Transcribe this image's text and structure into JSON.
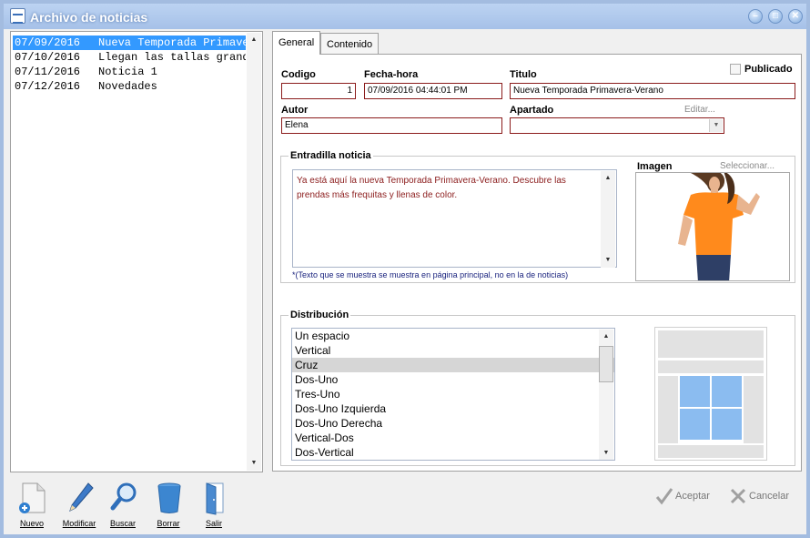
{
  "window": {
    "title": "Archivo de noticias"
  },
  "news_list": [
    {
      "date": "07/09/2016",
      "title": "Nueva Temporada Primavera-Verano",
      "selected": true
    },
    {
      "date": "07/10/2016",
      "title": "Llegan las tallas grandes",
      "selected": false
    },
    {
      "date": "07/11/2016",
      "title": "Noticia 1",
      "selected": false
    },
    {
      "date": "07/12/2016",
      "title": "Novedades",
      "selected": false
    }
  ],
  "tabs": [
    "General",
    "Contenido"
  ],
  "form": {
    "codigo_label": "Codigo",
    "codigo_value": "1",
    "fecha_label": "Fecha-hora",
    "fecha_value": "07/09/2016 04:44:01 PM",
    "titulo_label": "Titulo",
    "titulo_value": "Nueva Temporada Primavera-Verano",
    "publicado_label": "Publicado",
    "publicado_checked": false,
    "autor_label": "Autor",
    "autor_value": "Elena",
    "apartado_label": "Apartado",
    "apartado_value": "",
    "editar_label": "Editar..."
  },
  "entradilla": {
    "title": "Entradilla noticia",
    "text": "Ya está aquí la nueva Temporada Primavera-Verano. Descubre las prendas más frequitas y llenas de color.",
    "note": "*(Texto que se muestra se muestra en página principal, no en la de noticias)",
    "imagen_label": "Imagen",
    "seleccionar_label": "Seleccionar..."
  },
  "distribucion": {
    "title": "Distribución",
    "options": [
      "Un espacio",
      "Vertical",
      "Cruz",
      "Dos-Uno",
      "Tres-Uno",
      "Dos-Uno Izquierda",
      "Dos-Uno Derecha",
      "Vertical-Dos",
      "Dos-Vertical"
    ],
    "selected": "Cruz"
  },
  "toolbar": {
    "nuevo": "Nuevo",
    "modificar": "Modificar",
    "buscar": "Buscar",
    "borrar": "Borrar",
    "salir": "Salir"
  },
  "actions": {
    "aceptar": "Aceptar",
    "cancelar": "Cancelar"
  },
  "icons": [
    "app-icon",
    "minimize-icon",
    "maximize-icon",
    "close-icon",
    "new-document-icon",
    "pencil-icon",
    "magnifier-icon",
    "trash-icon",
    "exit-door-icon",
    "checkmark-icon",
    "cancel-x-icon"
  ],
  "colors": {
    "selection": "#3399ff",
    "field_border": "#8b1c1c",
    "titlebar": "#a6c1e8",
    "preview_cell": "#8bbcf0"
  }
}
